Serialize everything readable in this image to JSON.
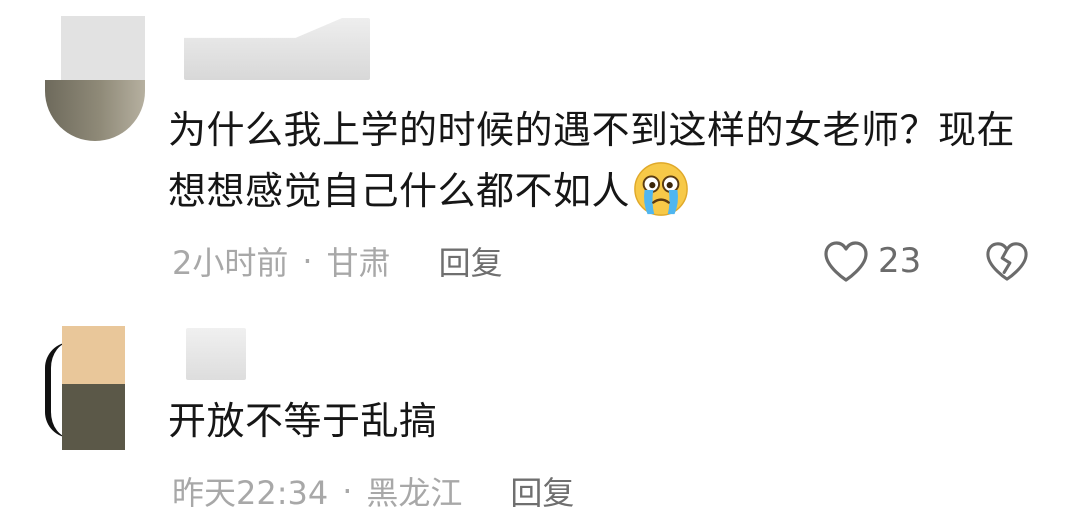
{
  "comments": [
    {
      "text": "为什么我上学的时候的遇不到这样的女老师？现在想想感觉自己什么都不如人",
      "emoji": "crying-face-emoji",
      "time": "2小时前",
      "separator": "·",
      "location": "甘肃",
      "reply_label": "回复",
      "likes": "23",
      "icons": {
        "like": "heart-outline-icon",
        "dislike": "broken-heart-icon"
      }
    },
    {
      "text": "开放不等于乱搞",
      "time": "昨天22:34",
      "separator": "·",
      "location": "黑龙江",
      "reply_label": "回复"
    }
  ],
  "colors": {
    "text": "#161616",
    "meta": "#a8a8a8",
    "reply": "#6f6f6f",
    "icon": "#6b6b6b"
  }
}
